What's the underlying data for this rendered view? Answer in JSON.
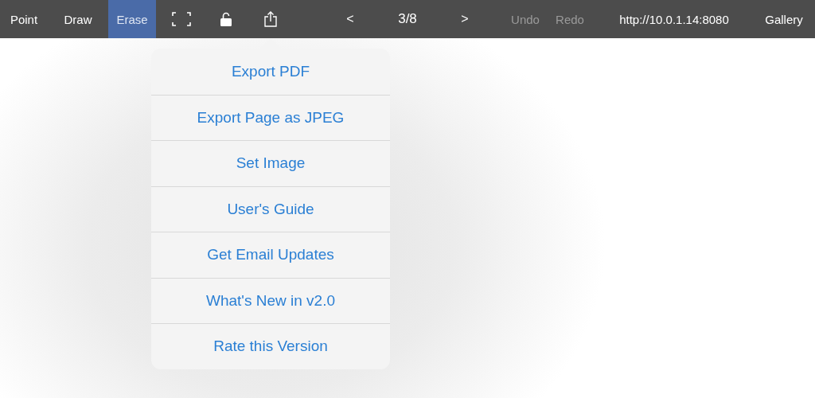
{
  "toolbar": {
    "items": [
      {
        "kind": "text",
        "label": "Point",
        "selected": false,
        "disabled": false
      },
      {
        "kind": "text",
        "label": "Draw",
        "selected": false,
        "disabled": false
      },
      {
        "kind": "text",
        "label": "Erase",
        "selected": true,
        "disabled": false
      },
      {
        "kind": "fullscreen"
      },
      {
        "kind": "lock"
      },
      {
        "kind": "share"
      },
      {
        "kind": "text",
        "label": "<",
        "selected": false,
        "disabled": false
      },
      {
        "kind": "page",
        "label": "3/8"
      },
      {
        "kind": "text",
        "label": ">",
        "selected": false,
        "disabled": false
      },
      {
        "kind": "text",
        "label": "Undo",
        "selected": false,
        "disabled": true
      },
      {
        "kind": "text",
        "label": "Redo",
        "selected": false,
        "disabled": true
      },
      {
        "kind": "page",
        "label": "http://10.0.1.14:8080"
      },
      {
        "kind": "text",
        "label": "Gallery",
        "selected": false,
        "disabled": false
      }
    ]
  },
  "share_menu": {
    "items": [
      "Export PDF",
      "Export Page as JPEG",
      "Set Image",
      "User's Guide",
      "Get Email Updates",
      "What's New in v2.0",
      "Rate this Version"
    ]
  }
}
